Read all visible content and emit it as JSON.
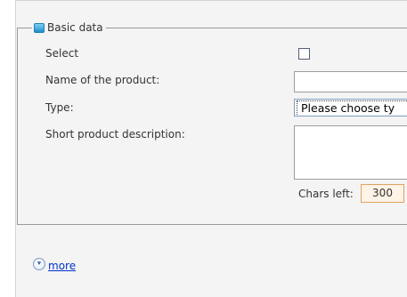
{
  "section": {
    "legend": "Basic data",
    "icon": "section-box-icon"
  },
  "fields": {
    "select_label": "Select",
    "name_label": "Name of the product:",
    "type_label": "Type:",
    "type_value": "Please choose ty",
    "description_label": "Short product description:",
    "name_value": "",
    "description_value": ""
  },
  "chars": {
    "label": "Chars left:",
    "count": "300"
  },
  "footer": {
    "more_label": "more",
    "more_icon": "expand-down-icon"
  },
  "colors": {
    "panel_bg": "#f4f4f4",
    "link": "#0033cc",
    "counter_border": "#e0a263"
  }
}
